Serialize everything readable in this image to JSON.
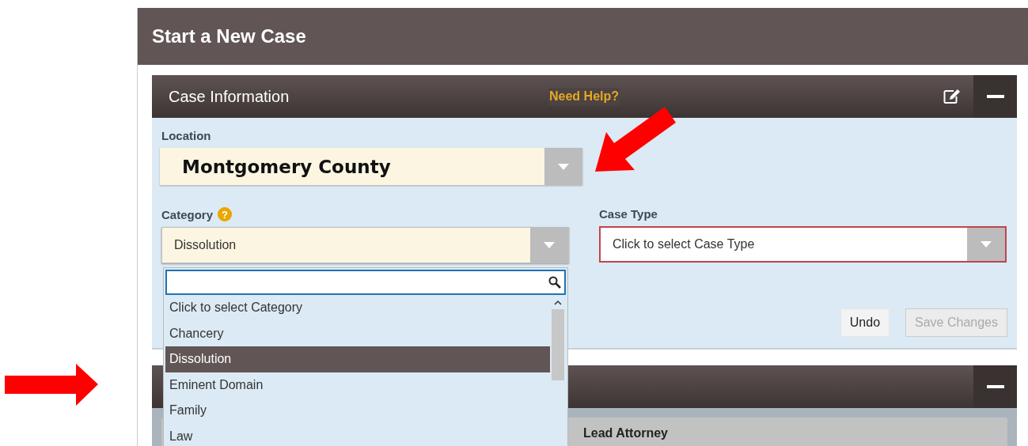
{
  "page": {
    "title": "Start a New Case"
  },
  "case_information": {
    "title": "Case Information",
    "help_link": "Need Help?",
    "location": {
      "label": "Location",
      "value": "Montgomery County"
    },
    "category": {
      "label": "Category",
      "help_icon": "?",
      "value": "Dissolution",
      "expanded": true,
      "options": [
        {
          "label": "Click to select Category",
          "selected": false
        },
        {
          "label": "Chancery",
          "selected": false
        },
        {
          "label": "Dissolution",
          "selected": true
        },
        {
          "label": "Eminent Domain",
          "selected": false
        },
        {
          "label": "Family",
          "selected": false
        },
        {
          "label": "Law",
          "selected": false
        }
      ]
    },
    "case_type": {
      "label": "Case Type",
      "placeholder": "Click to select Case Type",
      "invalid": true
    },
    "buttons": [
      {
        "label": "Undo",
        "disabled": false
      },
      {
        "label": "Save Changes",
        "disabled": true
      }
    ]
  },
  "second_section": {
    "card": {
      "title": "Lead Attorney"
    }
  }
}
